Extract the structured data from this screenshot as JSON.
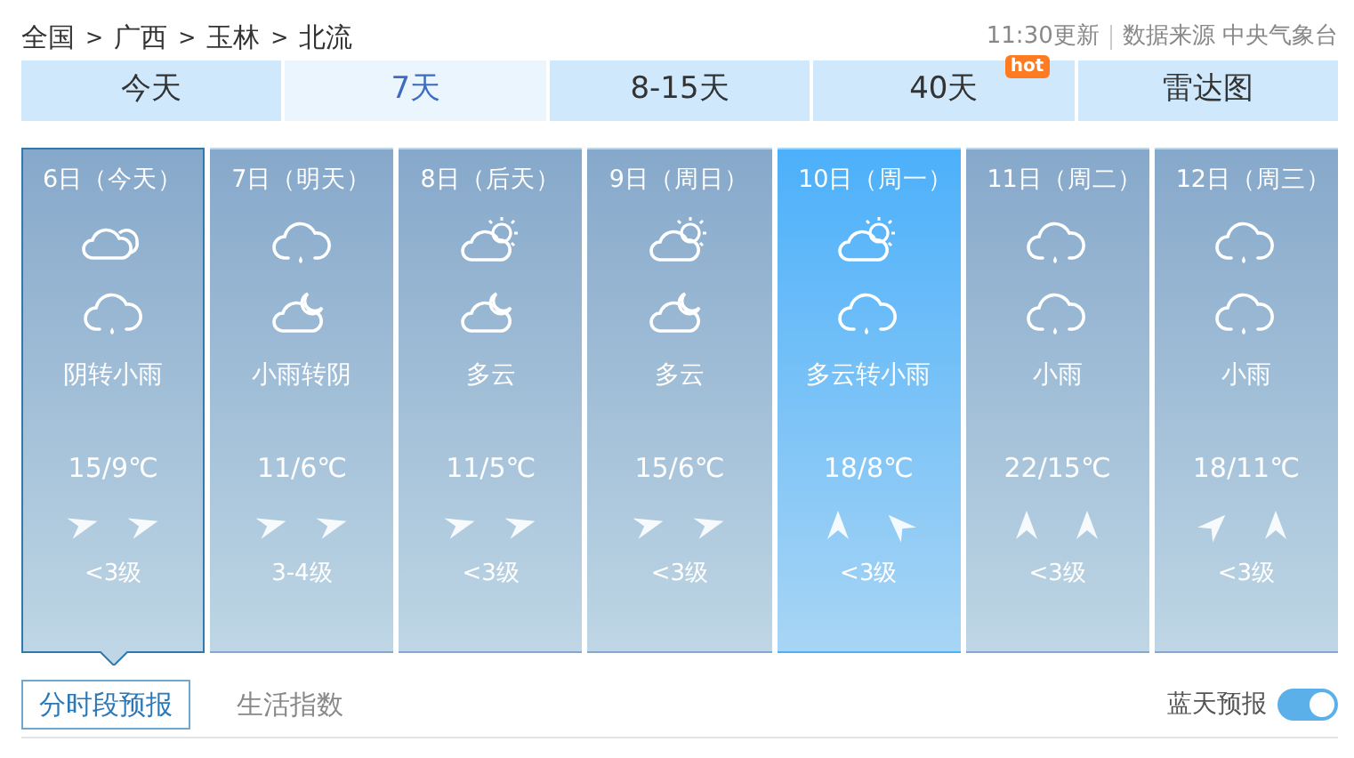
{
  "breadcrumb": [
    "全国",
    "广西",
    "玉林",
    "北流"
  ],
  "breadcrumb_separator": ">",
  "update_time": "11:30更新",
  "source": "数据来源 中央气象台",
  "tabs": [
    {
      "label": "今天",
      "selected": false
    },
    {
      "label": "7天",
      "selected": true
    },
    {
      "label": "8-15天",
      "selected": false
    },
    {
      "label": "40天",
      "selected": false,
      "badge": "hot"
    },
    {
      "label": "雷达图",
      "selected": false
    }
  ],
  "days": [
    {
      "date": "6日（今天）",
      "icons": [
        {
          "kind": "overcast"
        },
        {
          "kind": "rain"
        }
      ],
      "weather": "阴转小雨",
      "temp": "15/9℃",
      "wind_dirs": [
        {
          "kind": "e"
        },
        {
          "kind": "e"
        }
      ],
      "wind": "<3级",
      "selected": true,
      "highlighted": false
    },
    {
      "date": "7日（明天）",
      "icons": [
        {
          "kind": "rain"
        },
        {
          "kind": "cloudy-night"
        }
      ],
      "weather": "小雨转阴",
      "temp": "11/6℃",
      "wind_dirs": [
        {
          "kind": "e"
        },
        {
          "kind": "e"
        }
      ],
      "wind": "3-4级",
      "selected": false,
      "highlighted": false
    },
    {
      "date": "8日（后天）",
      "icons": [
        {
          "kind": "cloudy-day"
        },
        {
          "kind": "cloudy-night"
        }
      ],
      "weather": "多云",
      "temp": "11/5℃",
      "wind_dirs": [
        {
          "kind": "e"
        },
        {
          "kind": "e"
        }
      ],
      "wind": "<3级",
      "selected": false,
      "highlighted": false
    },
    {
      "date": "9日（周日）",
      "icons": [
        {
          "kind": "cloudy-day"
        },
        {
          "kind": "cloudy-night"
        }
      ],
      "weather": "多云",
      "temp": "15/6℃",
      "wind_dirs": [
        {
          "kind": "e"
        },
        {
          "kind": "e"
        }
      ],
      "wind": "<3级",
      "selected": false,
      "highlighted": false
    },
    {
      "date": "10日（周一）",
      "icons": [
        {
          "kind": "cloudy-day"
        },
        {
          "kind": "rain"
        }
      ],
      "weather": "多云转小雨",
      "temp": "18/8℃",
      "wind_dirs": [
        {
          "kind": "n"
        },
        {
          "kind": "nw"
        }
      ],
      "wind": "<3级",
      "selected": false,
      "highlighted": true
    },
    {
      "date": "11日（周二）",
      "icons": [
        {
          "kind": "rain"
        },
        {
          "kind": "rain"
        }
      ],
      "weather": "小雨",
      "temp": "22/15℃",
      "wind_dirs": [
        {
          "kind": "n"
        },
        {
          "kind": "n"
        }
      ],
      "wind": "<3级",
      "selected": false,
      "highlighted": false
    },
    {
      "date": "12日（周三）",
      "icons": [
        {
          "kind": "rain"
        },
        {
          "kind": "rain"
        }
      ],
      "weather": "小雨",
      "temp": "18/11℃",
      "wind_dirs": [
        {
          "kind": "ne"
        },
        {
          "kind": "n"
        }
      ],
      "wind": "<3级",
      "selected": false,
      "highlighted": false
    }
  ],
  "bottom_tabs": [
    {
      "label": "分时段预报",
      "selected": true
    },
    {
      "label": "生活指数",
      "selected": false
    }
  ],
  "blue_sky": {
    "label": "蓝天预报",
    "on": true
  }
}
